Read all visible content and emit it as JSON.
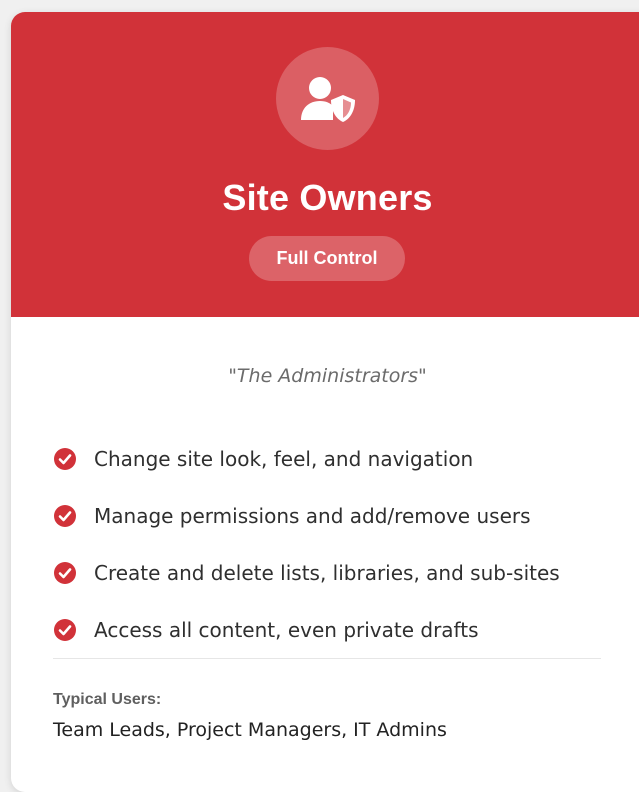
{
  "card": {
    "title": "Site Owners",
    "badge": "Full Control",
    "icon": "user-shield-icon",
    "tagline": "\"The Administrators\"",
    "features": [
      "Change site look, feel, and navigation",
      "Manage permissions and add/remove users",
      "Create and delete lists, libraries, and sub-sites",
      "Access all content, even private drafts"
    ],
    "typical_users_label": "Typical Users:",
    "typical_users": "Team Leads, Project Managers, IT Admins"
  },
  "colors": {
    "accent": "#d13239",
    "text": "#2f2f2f",
    "muted": "#6b6b6b"
  }
}
